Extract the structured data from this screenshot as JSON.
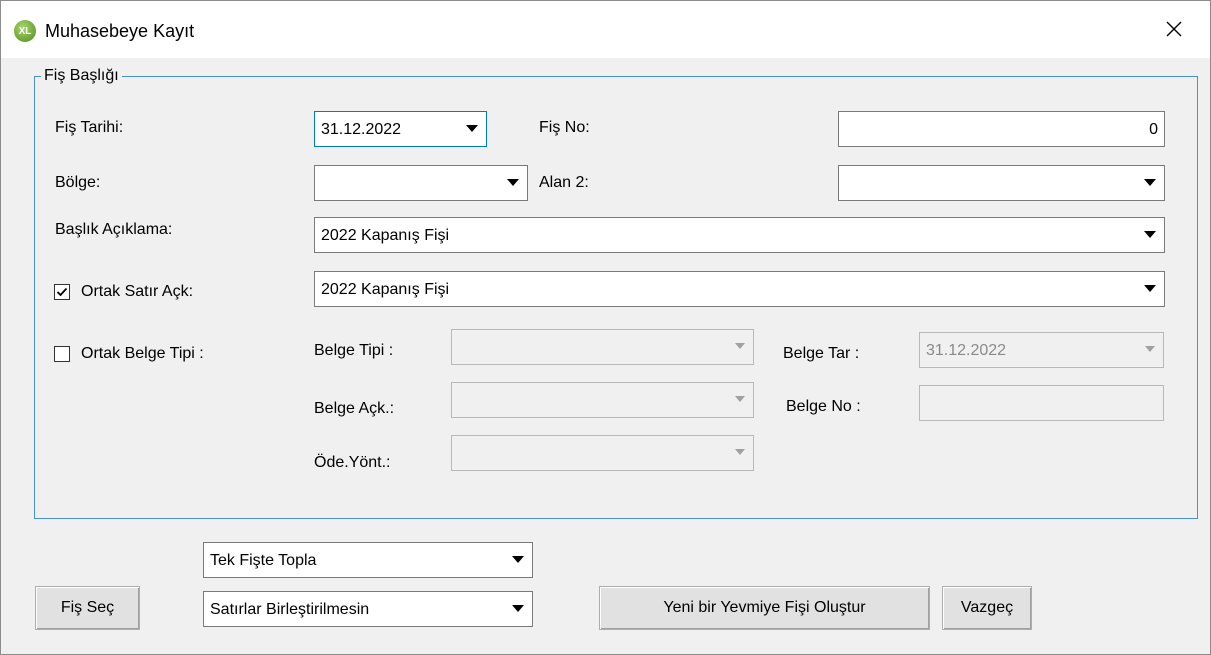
{
  "window": {
    "title": "Muhasebeye Kayıt",
    "icon": "app-logo-icon"
  },
  "group": {
    "legend": "Fiş Başlığı"
  },
  "fields": {
    "fis_tarihi": {
      "label": "Fiş Tarihi:",
      "value": "31.12.2022"
    },
    "fis_no": {
      "label": "Fiş No:",
      "value": "0"
    },
    "bolge": {
      "label": "Bölge:",
      "value": ""
    },
    "alan2": {
      "label": "Alan 2:",
      "value": ""
    },
    "baslik_aciklama": {
      "label": "Başlık Açıklama:",
      "value": "2022 Kapanış Fişi"
    },
    "ortak_satir": {
      "label": "Ortak Satır Açk:",
      "value": "2022 Kapanış Fişi",
      "checked": true
    },
    "ortak_belge": {
      "label": "Ortak Belge Tipi :",
      "checked": false
    },
    "belge_tipi": {
      "label": "Belge Tipi :",
      "value": ""
    },
    "belge_tar": {
      "label": "Belge Tar :",
      "value": "31.12.2022"
    },
    "belge_ack": {
      "label": "Belge Açk.:",
      "value": ""
    },
    "belge_no": {
      "label": "Belge No :",
      "value": ""
    },
    "ode_yont": {
      "label": "Öde.Yönt.:",
      "value": ""
    }
  },
  "bottom": {
    "mode_select": "Tek Fişte Topla",
    "merge_select": "Satırlar Birleştirilmesin",
    "fis_sec_button": "Fiş Seç",
    "create_button": "Yeni bir Yevmiye Fişi Oluştur",
    "cancel_button": "Vazgeç"
  },
  "colors": {
    "focus": "#0078d7",
    "group_border": "#4a90d9",
    "window_bg": "#f0f0f0"
  }
}
